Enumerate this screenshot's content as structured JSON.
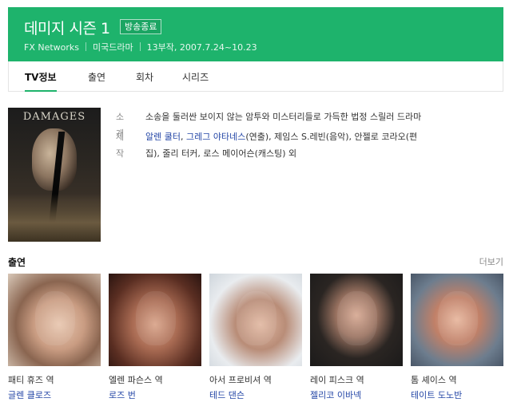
{
  "header": {
    "title": "데미지 시즌 1",
    "badge": "방송종료",
    "network": "FX Networks",
    "genre": "미국드라마",
    "schedule": "13부작, 2007.7.24~10.23",
    "color": "#1eb36c"
  },
  "tabs": [
    {
      "label": "TV정보",
      "active": true
    },
    {
      "label": "출연",
      "active": false
    },
    {
      "label": "회차",
      "active": false
    },
    {
      "label": "시리즈",
      "active": false
    }
  ],
  "poster": {
    "title": "DAMAGES"
  },
  "info": {
    "synopsis_label": "소개",
    "synopsis": "소송을 둘러싼 보이지 않는 암투와 미스터리들로 가득한 법정 스릴러 드라마",
    "production_label": "제작",
    "directors": "알렌 쿨터",
    "comma1": ", ",
    "director2": "그레그 야타네스",
    "production_rest_line1": "(연출), 제임스 S.레빈(음악), 안젤로 코라오(편",
    "production_rest_line2": "집), 줄리 터커, 로스 메이어슨(캐스팅) 외"
  },
  "cast_section": {
    "title": "출연",
    "more": "더보기"
  },
  "cast": [
    {
      "role": "패티 휴즈 역",
      "actor": "글렌 클로즈"
    },
    {
      "role": "엘렌 파슨스 역",
      "actor": "로즈 번"
    },
    {
      "role": "아서 프로비셔 역",
      "actor": "테드 댄슨"
    },
    {
      "role": "레이 피스크 역",
      "actor": "젤리코 이바넥"
    },
    {
      "role": "톰 셰이스 역",
      "actor": "테이트 도노반"
    }
  ]
}
